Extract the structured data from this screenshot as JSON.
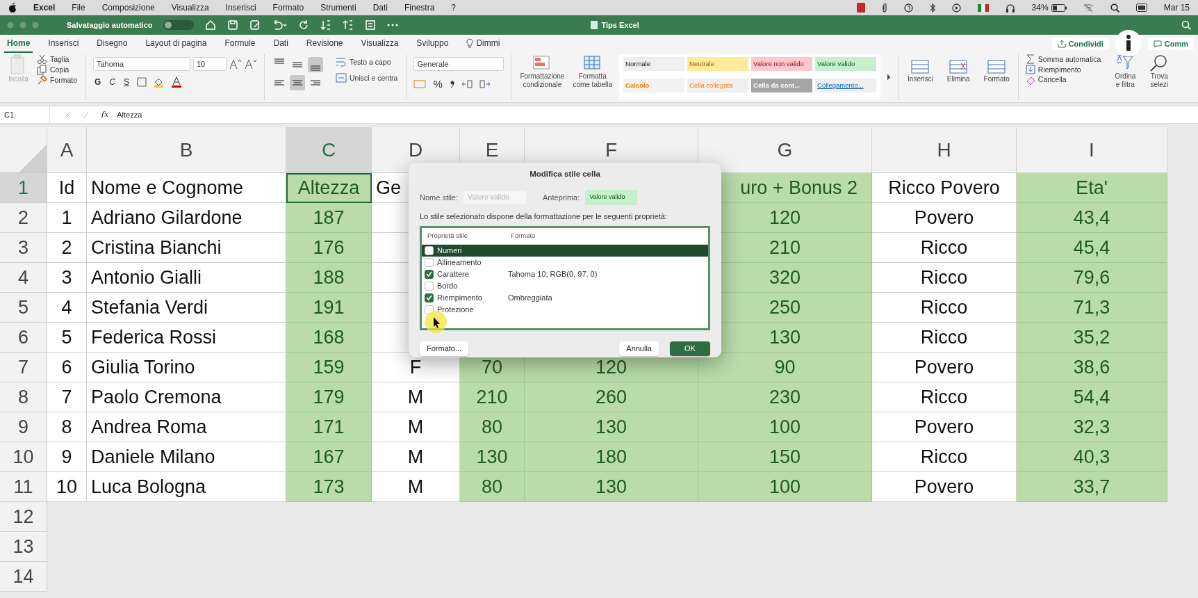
{
  "menubar": {
    "app": "Excel",
    "menus": [
      "File",
      "Composizione",
      "Visualizza",
      "Inserisci",
      "Formato",
      "Strumenti",
      "Dati",
      "Finestra",
      "?"
    ],
    "battery": "34%",
    "date": "Mar 15"
  },
  "titlebar": {
    "autosave_label": "Salvataggio automatico",
    "autosave_on": false,
    "title": "Tips Excel"
  },
  "tabs": [
    {
      "label": "Home",
      "selected": true
    },
    {
      "label": "Inserisci",
      "selected": false
    },
    {
      "label": "Disegno",
      "selected": false
    },
    {
      "label": "Layout di pagina",
      "selected": false
    },
    {
      "label": "Formule",
      "selected": false
    },
    {
      "label": "Dati",
      "selected": false
    },
    {
      "label": "Revisione",
      "selected": false
    },
    {
      "label": "Visualizza",
      "selected": false
    },
    {
      "label": "Sviluppo",
      "selected": false
    },
    {
      "label": "Dimmi",
      "selected": false
    }
  ],
  "share_buttons": [
    "Condividi",
    "Comm"
  ],
  "ribbon": {
    "clipboard": {
      "paste": "Incolla",
      "small": [
        "Taglia",
        "Copia",
        "Formato"
      ]
    },
    "font": {
      "name": "Tahoma",
      "size": "10",
      "styles": [
        "G",
        "C",
        "S"
      ]
    },
    "alignment": {
      "buttons": [
        {
          "pressed": false
        },
        {
          "pressed": false
        },
        {
          "pressed": true
        },
        {
          "pressed": false
        },
        {
          "pressed": true
        },
        {
          "pressed": false
        }
      ],
      "wrap": "Testo a capo",
      "merge": "Unisci e centra"
    },
    "number": {
      "format": "Generale",
      "percent": "%"
    },
    "styles": {
      "buttons": [
        "Formattazione\ncondizionale",
        "Formatta\ncome tabella"
      ],
      "gallery": [
        {
          "label": "Normale",
          "kind": "normal"
        },
        {
          "label": "Neutrale",
          "kind": "neutral"
        },
        {
          "label": "Valore non valido",
          "kind": "bad"
        },
        {
          "label": "Valore valido",
          "kind": "good"
        },
        {
          "label": "Calcolo",
          "kind": "calc"
        },
        {
          "label": "Cella collegata",
          "kind": "linked"
        },
        {
          "label": "Cella da cont...",
          "kind": "check"
        },
        {
          "label": "Collegamento...",
          "kind": "link"
        }
      ]
    },
    "cells": [
      "Inserisci",
      "Elimina",
      "Formato"
    ],
    "editing": {
      "small": [
        "Somma automatica",
        "Riempimento",
        "Cancella"
      ],
      "big": [
        "Ordina\ne filtra",
        "Trova\nselezi"
      ]
    }
  },
  "formula_bar": {
    "name_box": "C1",
    "fx": "fx",
    "content": "Altezza"
  },
  "grid": {
    "columns": [
      {
        "label": "A",
        "selected": false,
        "filled": false
      },
      {
        "label": "B",
        "selected": false,
        "filled": false
      },
      {
        "label": "C",
        "selected": true,
        "filled": true
      },
      {
        "label": "D",
        "selected": false,
        "filled": false
      },
      {
        "label": "E",
        "selected": false,
        "filled": true
      },
      {
        "label": "F",
        "selected": false,
        "filled": true
      },
      {
        "label": "G",
        "selected": false,
        "filled": true
      },
      {
        "label": "H",
        "selected": false,
        "filled": false
      },
      {
        "label": "I",
        "selected": false,
        "filled": true
      }
    ],
    "rows": [
      {
        "label": "1",
        "selected": true,
        "cells": [
          "Id",
          "Nome e Cognome",
          "Altezza",
          "Ge",
          null,
          null,
          "uro + Bonus 2",
          "Ricco Povero",
          "Eta'"
        ]
      },
      {
        "label": "2",
        "selected": false,
        "cells": [
          "1",
          "Adriano Gilardone",
          "187",
          null,
          null,
          null,
          "120",
          "Povero",
          "43,4"
        ]
      },
      {
        "label": "3",
        "selected": false,
        "cells": [
          "2",
          "Cristina Bianchi",
          "176",
          null,
          null,
          null,
          "210",
          "Ricco",
          "45,4"
        ]
      },
      {
        "label": "4",
        "selected": false,
        "cells": [
          "3",
          "Antonio Gialli",
          "188",
          null,
          null,
          null,
          "320",
          "Ricco",
          "79,6"
        ]
      },
      {
        "label": "5",
        "selected": false,
        "cells": [
          "4",
          "Stefania Verdi",
          "191",
          null,
          null,
          null,
          "250",
          "Ricco",
          "71,3"
        ]
      },
      {
        "label": "6",
        "selected": false,
        "cells": [
          "5",
          "Federica Rossi",
          "168",
          null,
          null,
          null,
          "130",
          "Ricco",
          "35,2"
        ]
      },
      {
        "label": "7",
        "selected": false,
        "cells": [
          "6",
          "Giulia Torino",
          "159",
          "F",
          "70",
          "120",
          "90",
          "Povero",
          "38,6"
        ]
      },
      {
        "label": "8",
        "selected": false,
        "cells": [
          "7",
          "Paolo Cremona",
          "179",
          "M",
          "210",
          "260",
          "230",
          "Ricco",
          "54,4"
        ]
      },
      {
        "label": "9",
        "selected": false,
        "cells": [
          "8",
          "Andrea Roma",
          "171",
          "M",
          "80",
          "130",
          "100",
          "Povero",
          "32,3"
        ]
      },
      {
        "label": "10",
        "selected": false,
        "cells": [
          "9",
          "Daniele Milano",
          "167",
          "M",
          "130",
          "180",
          "150",
          "Ricco",
          "40,3"
        ]
      },
      {
        "label": "11",
        "selected": false,
        "cells": [
          "10",
          "Luca Bologna",
          "173",
          "M",
          "80",
          "130",
          "100",
          "Povero",
          "33,7"
        ]
      },
      {
        "label": "12",
        "selected": false
      },
      {
        "label": "13",
        "selected": false
      },
      {
        "label": "14",
        "selected": false
      }
    ]
  },
  "dialog": {
    "title": "Modifica stile cella",
    "name_label": "Nome stile:",
    "name_value": "Valore valido",
    "preview_label": "Anteprima:",
    "preview": "Valore valido",
    "description": "Lo stile selezionato dispone della formattazione per le seguenti proprietà:",
    "columns": [
      "Proprietà stile",
      "Formato"
    ],
    "properties": [
      {
        "label": "Numeri",
        "checked": false,
        "selected": true
      },
      {
        "label": "Allineamento",
        "checked": false,
        "selected": false
      },
      {
        "label": "Carattere",
        "checked": true,
        "selected": false,
        "format": "Tahoma 10; RGB(0, 97, 0)"
      },
      {
        "label": "Bordo",
        "checked": false,
        "selected": false
      },
      {
        "label": "Riempimento",
        "checked": true,
        "selected": false,
        "format": "Ombreggiata"
      },
      {
        "label": "Protezione",
        "checked": false,
        "selected": false
      }
    ],
    "buttons": [
      {
        "label": "Formato...",
        "kind": "secondary"
      },
      {
        "label": "Annulla",
        "kind": "cancel"
      },
      {
        "label": "OK",
        "kind": "default"
      }
    ]
  }
}
